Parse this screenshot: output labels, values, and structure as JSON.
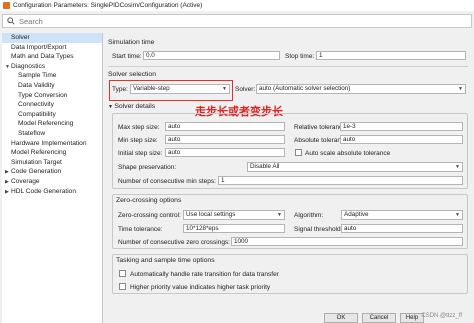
{
  "window": {
    "title": "Configuration Parameters: SinglePIDCosim/Configuration (Active)"
  },
  "search": {
    "placeholder": "Search"
  },
  "tree": [
    {
      "label": "Solver",
      "indent": 0,
      "arrow": "",
      "selected": true
    },
    {
      "label": "Data Import/Export",
      "indent": 0,
      "arrow": ""
    },
    {
      "label": "Math and Data Types",
      "indent": 0,
      "arrow": ""
    },
    {
      "label": "Diagnostics",
      "indent": 0,
      "arrow": "▼"
    },
    {
      "label": "Sample Time",
      "indent": 1,
      "arrow": ""
    },
    {
      "label": "Data Validity",
      "indent": 1,
      "arrow": ""
    },
    {
      "label": "Type Conversion",
      "indent": 1,
      "arrow": ""
    },
    {
      "label": "Connectivity",
      "indent": 1,
      "arrow": ""
    },
    {
      "label": "Compatibility",
      "indent": 1,
      "arrow": ""
    },
    {
      "label": "Model Referencing",
      "indent": 1,
      "arrow": ""
    },
    {
      "label": "Stateflow",
      "indent": 1,
      "arrow": ""
    },
    {
      "label": "Hardware Implementation",
      "indent": 0,
      "arrow": ""
    },
    {
      "label": "Model Referencing",
      "indent": 0,
      "arrow": ""
    },
    {
      "label": "Simulation Target",
      "indent": 0,
      "arrow": ""
    },
    {
      "label": "Code Generation",
      "indent": 0,
      "arrow": "▶"
    },
    {
      "label": "Coverage",
      "indent": 0,
      "arrow": "▶"
    },
    {
      "label": "HDL Code Generation",
      "indent": 0,
      "arrow": "▶"
    }
  ],
  "simulation_time": {
    "title": "Simulation time",
    "start_label": "Start time:",
    "start_value": "0.0",
    "stop_label": "Stop time:",
    "stop_value": "1"
  },
  "solver_selection": {
    "title": "Solver selection",
    "type_label": "Type:",
    "type_value": "Variable-step",
    "solver_label": "Solver:",
    "solver_value": "auto (Automatic solver selection)"
  },
  "annotation": "走步长或者变步长",
  "solver_details": {
    "title": "Solver details",
    "max_step_label": "Max step size:",
    "max_step_value": "auto",
    "min_step_label": "Min step size:",
    "min_step_value": "auto",
    "initial_step_label": "Initial step size:",
    "initial_step_value": "auto",
    "rel_tol_label": "Relative tolerance:",
    "rel_tol_value": "1e-3",
    "abs_tol_label": "Absolute tolerance:",
    "abs_tol_value": "auto",
    "auto_scale_label": "Auto scale absolute tolerance",
    "shape_label": "Shape preservation:",
    "shape_value": "Disable All",
    "consec_min_label": "Number of consecutive min steps:",
    "consec_min_value": "1"
  },
  "zero_crossing": {
    "title": "Zero-crossing options",
    "control_label": "Zero-crossing control:",
    "control_value": "Use local settings",
    "algorithm_label": "Algorithm:",
    "algorithm_value": "Adaptive",
    "time_tol_label": "Time tolerance:",
    "time_tol_value": "10*128*eps",
    "signal_threshold_label": "Signal threshold:",
    "signal_threshold_value": "auto",
    "consec_zc_label": "Number of consecutive zero crossings:",
    "consec_zc_value": "1000"
  },
  "tasking": {
    "title": "Tasking and sample time options",
    "opt1": "Automatically handle rate transition for data transfer",
    "opt2": "Higher priority value indicates higher task priority"
  },
  "buttons": {
    "ok": "OK",
    "cancel": "Cancel",
    "help": "Help",
    "apply": "Apply"
  },
  "watermark": "CSDN @ttzz_ff",
  "colors": {
    "annotation": "#e02020",
    "selected": "#cde3f7"
  }
}
